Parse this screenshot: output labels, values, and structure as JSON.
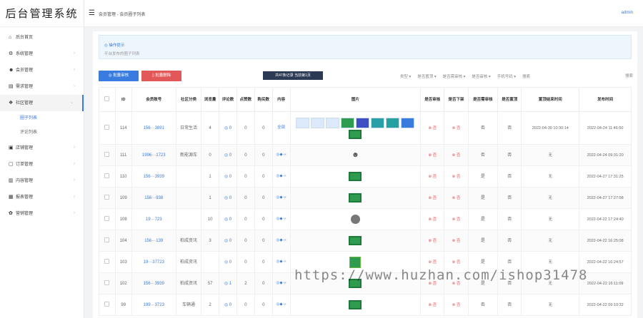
{
  "app": {
    "logo": "后台管理系统",
    "breadcrumb": "会员管理 - 会员圈子列表",
    "user": "admin"
  },
  "sidebar": {
    "items": [
      {
        "icon": "⌂",
        "icon_name": "home-icon",
        "label": "后台首页",
        "arrow": ""
      },
      {
        "icon": "⚙",
        "icon_name": "gear-icon",
        "label": "系统管理",
        "arrow": "›"
      },
      {
        "icon": "☻",
        "icon_name": "users-icon",
        "label": "会员管理",
        "arrow": "›"
      },
      {
        "icon": "▤",
        "icon_name": "doc-icon",
        "label": "需求管理",
        "arrow": "›"
      },
      {
        "icon": "❖",
        "icon_name": "community-icon",
        "label": "社区管理",
        "arrow": "⌄",
        "active": true
      }
    ],
    "subitems": [
      {
        "label": "圈子列表",
        "on": true
      },
      {
        "label": "评论列表",
        "on": false
      }
    ],
    "items2": [
      {
        "icon": "▣",
        "icon_name": "shop-icon",
        "label": "店铺管理",
        "arrow": "›"
      },
      {
        "icon": "▢",
        "icon_name": "order-icon",
        "label": "订单管理",
        "arrow": "›"
      },
      {
        "icon": "▥",
        "icon_name": "content-icon",
        "label": "内容管理",
        "arrow": "›"
      },
      {
        "icon": "▦",
        "icon_name": "report-icon",
        "label": "报表管理",
        "arrow": "›"
      },
      {
        "icon": "✿",
        "icon_name": "marketing-icon",
        "label": "营销管理",
        "arrow": "›"
      }
    ]
  },
  "tip": {
    "title": "◎ 操作提示",
    "text": "平台发布的圈子列表"
  },
  "toolbar": {
    "batch_review": "◎  批量审核",
    "batch_delete": "▯  批量删除",
    "count": "共47条记录  当前第1页",
    "filters": [
      "类型 ▾",
      "是否置顶 ▾",
      "是否需审核 ▾",
      "是否审核 ▾",
      "手机号码 ▾",
      "搜索"
    ],
    "refresh": "搜索"
  },
  "table": {
    "headers": [
      "",
      "ID",
      "会员账号",
      "社区分类",
      "浏览量",
      "评论数",
      "点赞数",
      "购买数",
      "内容",
      "图片",
      "是否审核",
      "是否下架",
      "是否需审核",
      "是否置顶",
      "置顶结束时间",
      "发布时间"
    ],
    "rows": [
      {
        "id": "114",
        "account": "156···3891",
        "cat": "日常生活",
        "views": "4",
        "comments": "◎ 0",
        "likes": "0",
        "buys": "0",
        "content": "全部",
        "pics": "multi",
        "review": "⊗ 否",
        "offline": "⊗ 否",
        "need": "否",
        "top": "否",
        "topend": "2022-04-30 10:30:14",
        "time": "2022-04-24 11:46:50",
        "tall": true
      },
      {
        "id": "111",
        "account": "1996···1723",
        "cat": "新能源车",
        "views": "0",
        "comments": "◎ 0",
        "likes": "0",
        "buys": "0",
        "content": "◎◆ ‹‹",
        "pics": "person",
        "review": "⊗ 否",
        "offline": "⊗ 否",
        "need": "否",
        "top": "否",
        "topend": "无",
        "time": "2022-04-24 09:31:20"
      },
      {
        "id": "110",
        "account": "156···3939",
        "cat": "",
        "views": "1",
        "comments": "◎ 0",
        "likes": "0",
        "buys": "0",
        "content": "◎◆ ‹‹",
        "pics": "green",
        "review": "⊗ 否",
        "offline": "⊗ 否",
        "need": "是",
        "top": "否",
        "topend": "无",
        "time": "2022-04-27 17:31:25"
      },
      {
        "id": "109",
        "account": "156···938",
        "cat": "",
        "views": "1",
        "comments": "◎ 0",
        "likes": "0",
        "buys": "0",
        "content": "◎◆ ‹‹",
        "pics": "green",
        "review": "⊗ 否",
        "offline": "⊗ 否",
        "need": "是",
        "top": "否",
        "topend": "无",
        "time": "2022-04-27 17:27:58"
      },
      {
        "id": "108",
        "account": "19···723",
        "cat": "",
        "views": "10",
        "comments": "◎ 0",
        "likes": "0",
        "buys": "0",
        "content": "◎◆ ‹‹",
        "pics": "grey",
        "review": "⊗ 否",
        "offline": "⊗ 否",
        "need": "是",
        "top": "否",
        "topend": "无",
        "time": "2022-04-22 17:24:40"
      },
      {
        "id": "104",
        "account": "156···139",
        "cat": "柏成资讯",
        "views": "3",
        "comments": "◎ 0",
        "likes": "0",
        "buys": "0",
        "content": "◎◆ ‹‹",
        "pics": "green",
        "review": "⊗ 否",
        "offline": "⊗ 否",
        "need": "是",
        "top": "否",
        "topend": "无",
        "time": "2022-04-22 16:25:08"
      },
      {
        "id": "103",
        "account": "19···37723",
        "cat": "柏成资讯",
        "views": "",
        "comments": "◎ 0",
        "likes": "0",
        "buys": "0",
        "content": "◎◆ ‹‹",
        "pics": "card",
        "review": "⊗ 否",
        "offline": "⊗ 否",
        "need": "是",
        "top": "否",
        "topend": "无",
        "time": "2022-04-22 16:24:57"
      },
      {
        "id": "102",
        "account": "156···3939",
        "cat": "柏成资讯",
        "views": "57",
        "comments": "◎ 1",
        "likes": "2",
        "buys": "0",
        "content": "◎◆ ‹‹",
        "pics": "green",
        "review": "⊗ 否",
        "offline": "⊗ 否",
        "need": "是",
        "top": "否",
        "topend": "无",
        "time": "2022-04-22 16:11:09"
      },
      {
        "id": "99",
        "account": "199···3723",
        "cat": "车辆通",
        "views": "2",
        "comments": "◎ 0",
        "likes": "0",
        "buys": "0",
        "content": "◎◆ ‹‹",
        "pics": "green",
        "review": "⊗ 否",
        "offline": "⊗ 否",
        "need": "否",
        "top": "否",
        "topend": "无",
        "time": "2022-04-22 09:10:32"
      }
    ]
  },
  "watermark": "https://www.huzhan.com/ishop31478"
}
